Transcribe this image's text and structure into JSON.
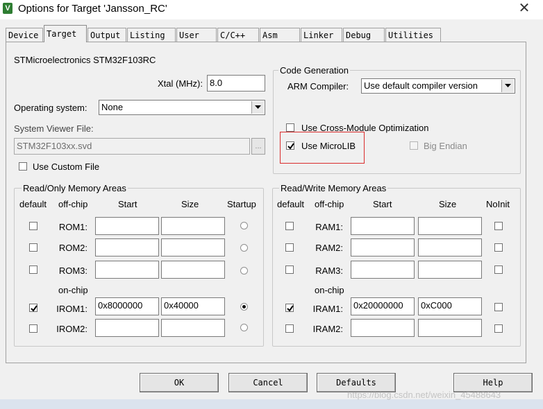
{
  "window": {
    "title": "Options for Target 'Jansson_RC'",
    "app_icon_glyph": "V"
  },
  "tabs": [
    "Device",
    "Target",
    "Output",
    "Listing",
    "User",
    "C/C++",
    "Asm",
    "Linker",
    "Debug",
    "Utilities"
  ],
  "active_tab": "Target",
  "target": {
    "device_name": "STMicroelectronics STM32F103RC",
    "xtal_label": "Xtal (MHz):",
    "xtal_value": "8.0",
    "os_label": "Operating system:",
    "os_value": "None",
    "svd_label": "System Viewer File:",
    "svd_value": "STM32F103xx.svd",
    "browse_label": "...",
    "custom_file_label": "Use Custom File",
    "custom_file_checked": false
  },
  "code_generation": {
    "title": "Code Generation",
    "compiler_label": "ARM Compiler:",
    "compiler_value": "Use default compiler version",
    "cross_module_label": "Use Cross-Module Optimization",
    "cross_module_checked": false,
    "microlib_label": "Use MicroLIB",
    "microlib_checked": true,
    "big_endian_label": "Big Endian",
    "big_endian_checked": false,
    "highlight_color": "#d92b2b"
  },
  "read_only": {
    "title": "Read/Only Memory Areas",
    "headers": {
      "default": "default",
      "offchip": "off-chip",
      "start": "Start",
      "size": "Size",
      "startup": "Startup"
    },
    "onchip_label": "on-chip",
    "rows": [
      {
        "name": "ROM1:",
        "default": false,
        "start": "",
        "size": "",
        "startup": false
      },
      {
        "name": "ROM2:",
        "default": false,
        "start": "",
        "size": "",
        "startup": false
      },
      {
        "name": "ROM3:",
        "default": false,
        "start": "",
        "size": "",
        "startup": false
      },
      {
        "name": "IROM1:",
        "default": true,
        "start": "0x8000000",
        "size": "0x40000",
        "startup": true
      },
      {
        "name": "IROM2:",
        "default": false,
        "start": "",
        "size": "",
        "startup": false
      }
    ]
  },
  "read_write": {
    "title": "Read/Write Memory Areas",
    "headers": {
      "default": "default",
      "offchip": "off-chip",
      "start": "Start",
      "size": "Size",
      "noinit": "NoInit"
    },
    "onchip_label": "on-chip",
    "rows": [
      {
        "name": "RAM1:",
        "default": false,
        "start": "",
        "size": "",
        "noinit": false
      },
      {
        "name": "RAM2:",
        "default": false,
        "start": "",
        "size": "",
        "noinit": false
      },
      {
        "name": "RAM3:",
        "default": false,
        "start": "",
        "size": "",
        "noinit": false
      },
      {
        "name": "IRAM1:",
        "default": true,
        "start": "0x20000000",
        "size": "0xC000",
        "noinit": false
      },
      {
        "name": "IRAM2:",
        "default": false,
        "start": "",
        "size": "",
        "noinit": false
      }
    ]
  },
  "buttons": {
    "ok": "OK",
    "cancel": "Cancel",
    "defaults": "Defaults",
    "help": "Help"
  },
  "watermark": "https://blog.csdn.net/weixin_45488643"
}
